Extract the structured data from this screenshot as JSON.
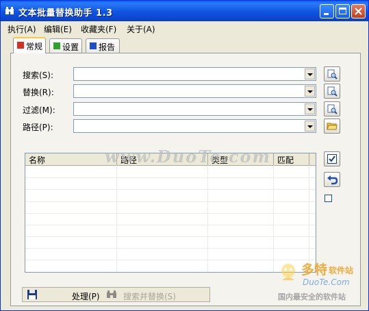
{
  "window": {
    "title": "文本批量替换助手  1.3"
  },
  "menu": [
    "执行(A)",
    "编辑(E)",
    "收藏夹(F)",
    "关于(A)"
  ],
  "tabs": [
    {
      "label": "常规",
      "active": true,
      "icon_color": "#d83020"
    },
    {
      "label": "设置",
      "active": false,
      "icon_color": "#30a030"
    },
    {
      "label": "报告",
      "active": false,
      "icon_color": "#2050c8"
    }
  ],
  "fields": [
    {
      "label": "搜索(S):",
      "value": "",
      "button_icon": "folder-search-icon"
    },
    {
      "label": "替换(R):",
      "value": "",
      "button_icon": "folder-search-icon"
    },
    {
      "label": "过滤(M):",
      "value": "",
      "button_icon": "folder-search-icon"
    },
    {
      "label": "路径(P):",
      "value": "",
      "button_icon": "open-folder-icon"
    }
  ],
  "results": {
    "columns": [
      "名称",
      "路径",
      "类型",
      "匹配"
    ],
    "rows": []
  },
  "side_buttons": [
    "check-all-icon",
    "undo-icon"
  ],
  "side_checkbox_checked": false,
  "bottom": {
    "save_icon": "save-disk-icon",
    "process_label": "处理(P)",
    "search_replace_label": "搜索并替换(S)",
    "search_replace_enabled": false
  },
  "watermark": "www.DuoTe.com",
  "logo": {
    "line1": "多特",
    "line1b": "软件站",
    "line2": "DuoTe.Com",
    "line3": "国内最安全的软件站"
  }
}
